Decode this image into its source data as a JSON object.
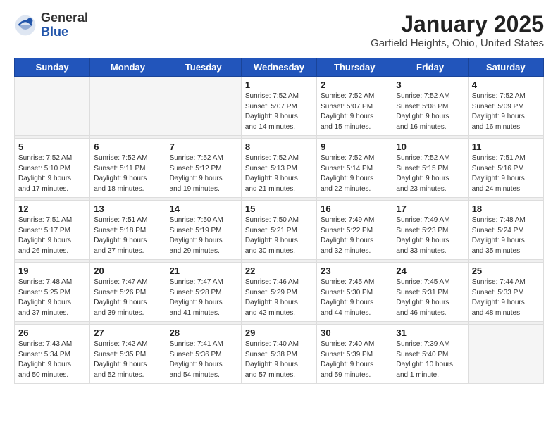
{
  "logo": {
    "general": "General",
    "blue": "Blue"
  },
  "header": {
    "month": "January 2025",
    "location": "Garfield Heights, Ohio, United States"
  },
  "days_of_week": [
    "Sunday",
    "Monday",
    "Tuesday",
    "Wednesday",
    "Thursday",
    "Friday",
    "Saturday"
  ],
  "weeks": [
    [
      {
        "day": "",
        "info": ""
      },
      {
        "day": "",
        "info": ""
      },
      {
        "day": "",
        "info": ""
      },
      {
        "day": "1",
        "info": "Sunrise: 7:52 AM\nSunset: 5:07 PM\nDaylight: 9 hours\nand 14 minutes."
      },
      {
        "day": "2",
        "info": "Sunrise: 7:52 AM\nSunset: 5:07 PM\nDaylight: 9 hours\nand 15 minutes."
      },
      {
        "day": "3",
        "info": "Sunrise: 7:52 AM\nSunset: 5:08 PM\nDaylight: 9 hours\nand 16 minutes."
      },
      {
        "day": "4",
        "info": "Sunrise: 7:52 AM\nSunset: 5:09 PM\nDaylight: 9 hours\nand 16 minutes."
      }
    ],
    [
      {
        "day": "5",
        "info": "Sunrise: 7:52 AM\nSunset: 5:10 PM\nDaylight: 9 hours\nand 17 minutes."
      },
      {
        "day": "6",
        "info": "Sunrise: 7:52 AM\nSunset: 5:11 PM\nDaylight: 9 hours\nand 18 minutes."
      },
      {
        "day": "7",
        "info": "Sunrise: 7:52 AM\nSunset: 5:12 PM\nDaylight: 9 hours\nand 19 minutes."
      },
      {
        "day": "8",
        "info": "Sunrise: 7:52 AM\nSunset: 5:13 PM\nDaylight: 9 hours\nand 21 minutes."
      },
      {
        "day": "9",
        "info": "Sunrise: 7:52 AM\nSunset: 5:14 PM\nDaylight: 9 hours\nand 22 minutes."
      },
      {
        "day": "10",
        "info": "Sunrise: 7:52 AM\nSunset: 5:15 PM\nDaylight: 9 hours\nand 23 minutes."
      },
      {
        "day": "11",
        "info": "Sunrise: 7:51 AM\nSunset: 5:16 PM\nDaylight: 9 hours\nand 24 minutes."
      }
    ],
    [
      {
        "day": "12",
        "info": "Sunrise: 7:51 AM\nSunset: 5:17 PM\nDaylight: 9 hours\nand 26 minutes."
      },
      {
        "day": "13",
        "info": "Sunrise: 7:51 AM\nSunset: 5:18 PM\nDaylight: 9 hours\nand 27 minutes."
      },
      {
        "day": "14",
        "info": "Sunrise: 7:50 AM\nSunset: 5:19 PM\nDaylight: 9 hours\nand 29 minutes."
      },
      {
        "day": "15",
        "info": "Sunrise: 7:50 AM\nSunset: 5:21 PM\nDaylight: 9 hours\nand 30 minutes."
      },
      {
        "day": "16",
        "info": "Sunrise: 7:49 AM\nSunset: 5:22 PM\nDaylight: 9 hours\nand 32 minutes."
      },
      {
        "day": "17",
        "info": "Sunrise: 7:49 AM\nSunset: 5:23 PM\nDaylight: 9 hours\nand 33 minutes."
      },
      {
        "day": "18",
        "info": "Sunrise: 7:48 AM\nSunset: 5:24 PM\nDaylight: 9 hours\nand 35 minutes."
      }
    ],
    [
      {
        "day": "19",
        "info": "Sunrise: 7:48 AM\nSunset: 5:25 PM\nDaylight: 9 hours\nand 37 minutes."
      },
      {
        "day": "20",
        "info": "Sunrise: 7:47 AM\nSunset: 5:26 PM\nDaylight: 9 hours\nand 39 minutes."
      },
      {
        "day": "21",
        "info": "Sunrise: 7:47 AM\nSunset: 5:28 PM\nDaylight: 9 hours\nand 41 minutes."
      },
      {
        "day": "22",
        "info": "Sunrise: 7:46 AM\nSunset: 5:29 PM\nDaylight: 9 hours\nand 42 minutes."
      },
      {
        "day": "23",
        "info": "Sunrise: 7:45 AM\nSunset: 5:30 PM\nDaylight: 9 hours\nand 44 minutes."
      },
      {
        "day": "24",
        "info": "Sunrise: 7:45 AM\nSunset: 5:31 PM\nDaylight: 9 hours\nand 46 minutes."
      },
      {
        "day": "25",
        "info": "Sunrise: 7:44 AM\nSunset: 5:33 PM\nDaylight: 9 hours\nand 48 minutes."
      }
    ],
    [
      {
        "day": "26",
        "info": "Sunrise: 7:43 AM\nSunset: 5:34 PM\nDaylight: 9 hours\nand 50 minutes."
      },
      {
        "day": "27",
        "info": "Sunrise: 7:42 AM\nSunset: 5:35 PM\nDaylight: 9 hours\nand 52 minutes."
      },
      {
        "day": "28",
        "info": "Sunrise: 7:41 AM\nSunset: 5:36 PM\nDaylight: 9 hours\nand 54 minutes."
      },
      {
        "day": "29",
        "info": "Sunrise: 7:40 AM\nSunset: 5:38 PM\nDaylight: 9 hours\nand 57 minutes."
      },
      {
        "day": "30",
        "info": "Sunrise: 7:40 AM\nSunset: 5:39 PM\nDaylight: 9 hours\nand 59 minutes."
      },
      {
        "day": "31",
        "info": "Sunrise: 7:39 AM\nSunset: 5:40 PM\nDaylight: 10 hours\nand 1 minute."
      },
      {
        "day": "",
        "info": ""
      }
    ]
  ]
}
